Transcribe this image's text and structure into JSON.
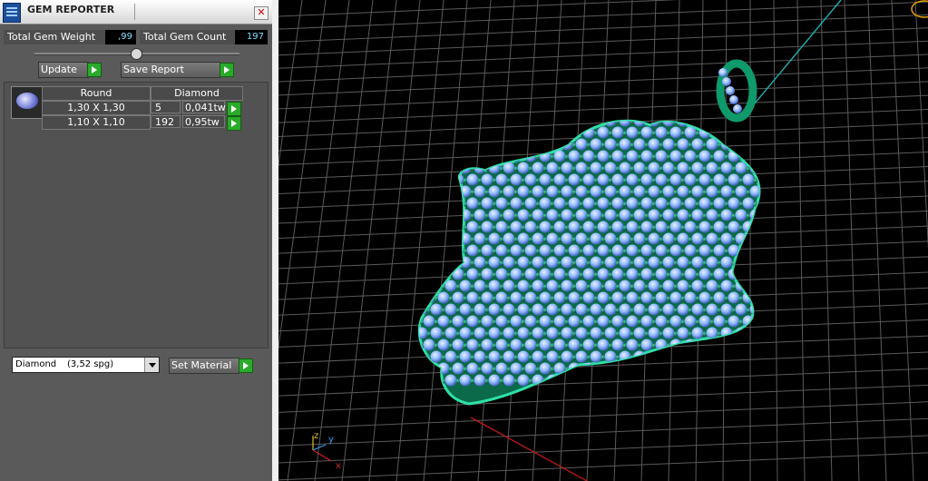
{
  "window": {
    "title": "GEM REPORTER",
    "close_symbol": "✕"
  },
  "summary": {
    "weight_label": "Total Gem Weight",
    "weight_value": ",99",
    "count_label": "Total Gem Count",
    "count_value": "197"
  },
  "actions": {
    "update_label": "Update",
    "save_report_label": "Save Report"
  },
  "table": {
    "headers": [
      "Round",
      "Diamond"
    ],
    "rows": [
      {
        "size": "1,30 X 1,30",
        "count": "5",
        "weight": "0,041tw"
      },
      {
        "size": "1,10 X 1,10",
        "count": "192",
        "weight": "0,95tw"
      }
    ]
  },
  "material": {
    "selected_name": "Diamond",
    "selected_density": "(3,52 spg)",
    "set_label": "Set Material"
  },
  "viewport": {
    "axis_z": "z",
    "axis_y": "y",
    "axis_x": "x"
  },
  "colors": {
    "panel": "#5a5a5a",
    "value_text": "#7fe0ff",
    "go_button": "#2aaa2a",
    "metal": "#0e7a55",
    "gem": "#8fb8ff",
    "grid": "#5a5a5a"
  }
}
